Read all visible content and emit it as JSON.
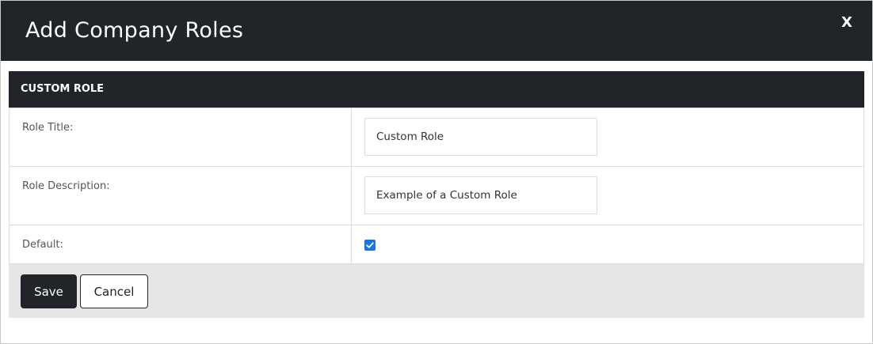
{
  "dialog": {
    "title": "Add Company Roles",
    "close_label": "X"
  },
  "section": {
    "header": "CUSTOM ROLE"
  },
  "form": {
    "role_title": {
      "label": "Role Title:",
      "value": "Custom Role"
    },
    "role_description": {
      "label": "Role Description:",
      "value": "Example of a Custom Role"
    },
    "default": {
      "label": "Default:",
      "checked": true
    }
  },
  "footer": {
    "save_label": "Save",
    "cancel_label": "Cancel"
  },
  "colors": {
    "header_bg": "#212429",
    "footer_bg": "#e6e6e6",
    "checkbox_accent": "#1a73e8"
  }
}
